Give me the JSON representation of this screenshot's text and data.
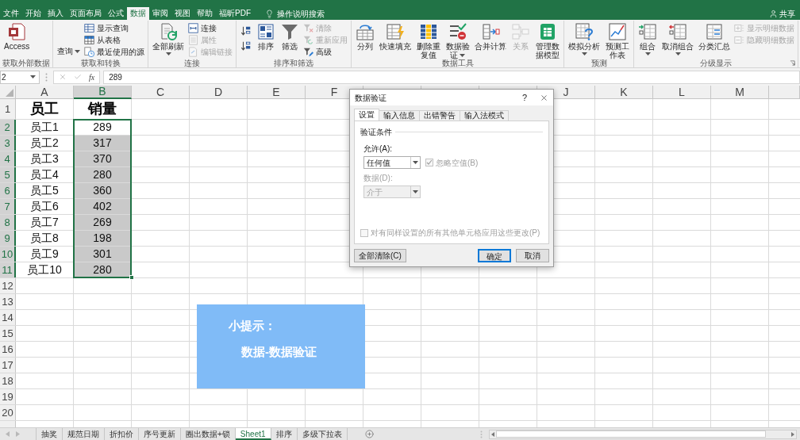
{
  "ribbon": {
    "tabs": [
      {
        "label": "文件",
        "selected": false
      },
      {
        "label": "开始",
        "selected": false
      },
      {
        "label": "插入",
        "selected": false
      },
      {
        "label": "页面布局",
        "selected": false
      },
      {
        "label": "公式",
        "selected": false
      },
      {
        "label": "数据",
        "selected": true
      },
      {
        "label": "审阅",
        "selected": false
      },
      {
        "label": "视图",
        "selected": false
      },
      {
        "label": "帮助",
        "selected": false
      },
      {
        "label": "福昕PDF",
        "selected": false
      }
    ],
    "tell_me": "操作说明搜索",
    "share": "共享",
    "groups": [
      {
        "label": "获取外部数据",
        "launcher": false,
        "items": [
          {
            "kind": "large",
            "label": "Access",
            "disabled": false,
            "dropdown": false
          }
        ]
      },
      {
        "label": "获取和转换",
        "launcher": false,
        "items": [
          {
            "kind": "large",
            "label": "查询",
            "disabled": false,
            "dropdown": true
          },
          {
            "kind": "small",
            "label": "显示查询",
            "disabled": false,
            "dropdown": false
          },
          {
            "kind": "small",
            "label": "从表格",
            "disabled": false,
            "dropdown": false
          },
          {
            "kind": "small",
            "label": "最近使用的源",
            "disabled": false,
            "dropdown": false
          }
        ]
      },
      {
        "label": "连接",
        "launcher": false,
        "items": [
          {
            "kind": "large",
            "label": "全部刷新",
            "disabled": false,
            "dropdown": true
          },
          {
            "kind": "small",
            "label": "连接",
            "disabled": false,
            "dropdown": false
          },
          {
            "kind": "small",
            "label": "属性",
            "disabled": true,
            "dropdown": false
          },
          {
            "kind": "small",
            "label": "编辑链接",
            "disabled": true,
            "dropdown": false
          }
        ]
      },
      {
        "label": "排序和筛选",
        "launcher": false,
        "items": [
          {
            "kind": "icon",
            "disabled": false,
            "dropdown": false
          },
          {
            "kind": "icon",
            "disabled": false,
            "dropdown": false
          },
          {
            "kind": "large",
            "label": "排序",
            "disabled": false,
            "dropdown": false
          },
          {
            "kind": "large",
            "label": "筛选",
            "disabled": false,
            "dropdown": false
          },
          {
            "kind": "small",
            "label": "清除",
            "disabled": true,
            "dropdown": false
          },
          {
            "kind": "small",
            "label": "重新应用",
            "disabled": true,
            "dropdown": false
          },
          {
            "kind": "small",
            "label": "高级",
            "disabled": false,
            "dropdown": false
          }
        ]
      },
      {
        "label": "数据工具",
        "launcher": false,
        "items": [
          {
            "kind": "large",
            "label": "分列",
            "disabled": false,
            "dropdown": false
          },
          {
            "kind": "large",
            "label": "快速填充",
            "disabled": false,
            "dropdown": false
          },
          {
            "kind": "stacked",
            "label": "删除重复值",
            "disabled": false,
            "dropdown": false
          },
          {
            "kind": "stacked",
            "label": "数据验证",
            "disabled": false,
            "dropdown": true
          },
          {
            "kind": "large",
            "label": "合并计算",
            "disabled": false,
            "dropdown": false
          },
          {
            "kind": "large",
            "label": "关系",
            "disabled": true,
            "dropdown": false
          },
          {
            "kind": "stacked",
            "label": "管理数据模型",
            "disabled": false,
            "dropdown": false
          }
        ]
      },
      {
        "label": "预测",
        "launcher": false,
        "items": [
          {
            "kind": "large",
            "label": "模拟分析",
            "disabled": false,
            "dropdown": true
          },
          {
            "kind": "stacked",
            "label": "预测工作表",
            "disabled": false,
            "dropdown": false
          }
        ]
      },
      {
        "label": "分级显示",
        "launcher": true,
        "items": [
          {
            "kind": "large",
            "label": "组合",
            "disabled": false,
            "dropdown": true
          },
          {
            "kind": "large",
            "label": "取消组合",
            "disabled": false,
            "dropdown": true
          },
          {
            "kind": "large",
            "label": "分类汇总",
            "disabled": false,
            "dropdown": false
          },
          {
            "kind": "small",
            "label": "显示明细数据",
            "disabled": true,
            "dropdown": false
          },
          {
            "kind": "small",
            "label": "隐藏明细数据",
            "disabled": true,
            "dropdown": false
          }
        ]
      }
    ]
  },
  "formula_bar": {
    "name_box": "2",
    "function_label": "fx",
    "value": "289"
  },
  "sheet": {
    "columns": [
      {
        "label": "A",
        "selected": false
      },
      {
        "label": "B",
        "selected": true
      },
      {
        "label": "C",
        "selected": false
      },
      {
        "label": "D",
        "selected": false
      },
      {
        "label": "E",
        "selected": false
      },
      {
        "label": "F",
        "selected": false
      },
      {
        "selected": false
      },
      {
        "selected": false
      },
      {
        "selected": false
      },
      {
        "label": "J",
        "selected": false
      },
      {
        "label": "K",
        "selected": false
      },
      {
        "label": "L",
        "selected": false
      },
      {
        "label": "M",
        "selected": false
      },
      {
        "selected": false
      }
    ],
    "rows": [
      {
        "label": "1",
        "kind": "header",
        "selected": false,
        "cells": [
          "员工",
          "销量"
        ]
      },
      {
        "label": "2",
        "kind": "data",
        "selected": true,
        "cells": [
          "员工1",
          "289"
        ]
      },
      {
        "label": "3",
        "kind": "data",
        "selected": true,
        "cells": [
          "员工2",
          "317"
        ]
      },
      {
        "label": "4",
        "kind": "data",
        "selected": true,
        "cells": [
          "员工3",
          "370"
        ]
      },
      {
        "label": "5",
        "kind": "data",
        "selected": true,
        "cells": [
          "员工4",
          "280"
        ]
      },
      {
        "label": "6",
        "kind": "data",
        "selected": true,
        "cells": [
          "员工5",
          "360"
        ]
      },
      {
        "label": "7",
        "kind": "data",
        "selected": true,
        "cells": [
          "员工6",
          "402"
        ]
      },
      {
        "label": "8",
        "kind": "data",
        "selected": true,
        "cells": [
          "员工7",
          "269"
        ]
      },
      {
        "label": "9",
        "kind": "data",
        "selected": true,
        "cells": [
          "员工8",
          "198"
        ]
      },
      {
        "label": "10",
        "kind": "data",
        "selected": true,
        "cells": [
          "员工9",
          "301"
        ]
      },
      {
        "label": "11",
        "kind": "data",
        "selected": true,
        "cells": [
          "员工10",
          "280"
        ]
      },
      {
        "label": "12",
        "kind": "data",
        "selected": false
      },
      {
        "label": "13",
        "kind": "data",
        "selected": false
      },
      {
        "label": "14",
        "kind": "data",
        "selected": false
      },
      {
        "label": "15",
        "kind": "data",
        "selected": false
      },
      {
        "label": "16",
        "kind": "data",
        "selected": false
      },
      {
        "label": "17",
        "kind": "data",
        "selected": false
      },
      {
        "label": "18",
        "kind": "data",
        "selected": false
      },
      {
        "label": "19",
        "kind": "data",
        "selected": false
      },
      {
        "label": "20",
        "kind": "data",
        "selected": false
      }
    ]
  },
  "tip": {
    "title": "小提示：",
    "text": "数据-数据验证"
  },
  "dialog": {
    "title": "数据验证",
    "help": "?",
    "tabs": [
      {
        "label": "设置",
        "selected": true
      },
      {
        "label": "输入信息",
        "selected": false
      },
      {
        "label": "出错警告",
        "selected": false
      },
      {
        "label": "输入法模式",
        "selected": false
      }
    ],
    "section": "验证条件",
    "allow": {
      "label": "允许(A):",
      "value": "任何值",
      "disabled": false
    },
    "ignore_blank": {
      "label": "忽略空值(B)",
      "checked": true,
      "disabled": true
    },
    "data": {
      "label": "数据(D):",
      "value": "介于",
      "disabled": true
    },
    "apply_all": {
      "label": "对有同样设置的所有其他单元格应用这些更改(P)",
      "checked": false,
      "disabled": true
    },
    "buttons": [
      {
        "label": "全部清除(C)",
        "default": false
      },
      {
        "label": "确定",
        "default": true
      },
      {
        "label": "取消",
        "default": false
      }
    ]
  },
  "sheet_tabs": [
    {
      "label": "抽奖",
      "selected": false
    },
    {
      "label": "规范日期",
      "selected": false
    },
    {
      "label": "折扣价",
      "selected": false
    },
    {
      "label": "序号更新",
      "selected": false
    },
    {
      "label": "圈出数据+锁",
      "selected": false
    },
    {
      "label": "Sheet1",
      "selected": true
    },
    {
      "label": "排序",
      "selected": false
    },
    {
      "label": "多级下拉表",
      "selected": false
    }
  ]
}
